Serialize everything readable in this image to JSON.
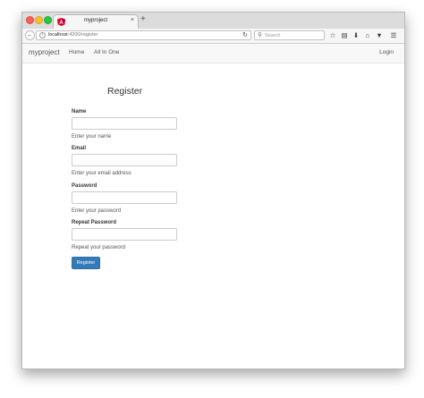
{
  "browser": {
    "tab_title": "myproject",
    "new_tab_label": "+",
    "close_tab_label": "×",
    "url_host": "localhost",
    "url_port_path": ":4200/register",
    "search_placeholder": "Search",
    "toolbar_icons": [
      "star-icon",
      "clipboard-icon",
      "download-icon",
      "home-icon",
      "pocket-icon",
      "menu-icon"
    ]
  },
  "navbar": {
    "brand": "myproject",
    "links": [
      "Home",
      "All In One"
    ],
    "login": "Login"
  },
  "form": {
    "title": "Register",
    "fields": [
      {
        "label": "Name",
        "help": "Enter your name",
        "value": ""
      },
      {
        "label": "Email",
        "help": "Enter your email address",
        "value": ""
      },
      {
        "label": "Password",
        "help": "Enter your password",
        "value": ""
      },
      {
        "label": "Repeat Password",
        "help": "Repeat your password",
        "value": ""
      }
    ],
    "submit_label": "Register"
  },
  "colors": {
    "primary_button": "#337ab7",
    "navbar_background": "#f8f8f8",
    "angular_red": "#dd0031"
  }
}
